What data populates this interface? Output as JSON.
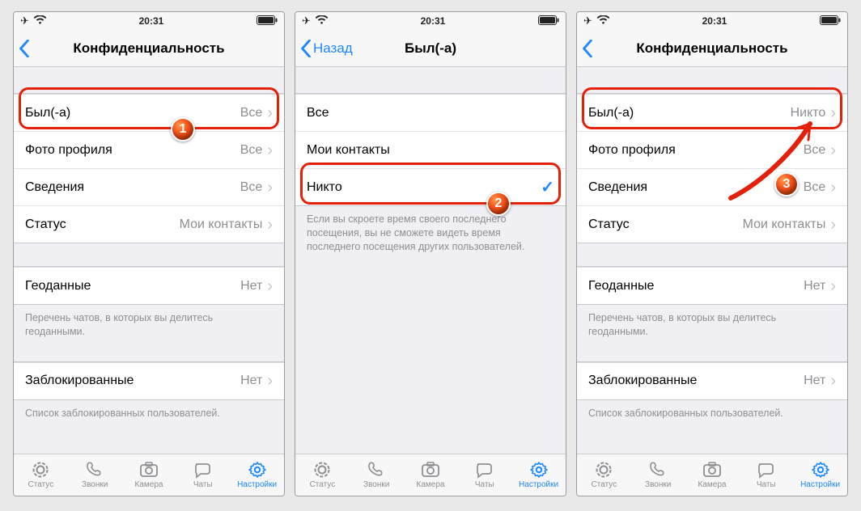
{
  "status": {
    "time": "20:31"
  },
  "titles": {
    "privacy": "Конфиденциальность",
    "back": "Назад",
    "lastseen": "Был(-а)"
  },
  "privacy_rows": {
    "last_seen": "Был(-а)",
    "profile_photo": "Фото профиля",
    "about": "Сведения",
    "status": "Статус",
    "live_location": "Геоданные",
    "blocked": "Заблокированные"
  },
  "values": {
    "all": "Все",
    "contacts": "Мои контакты",
    "none": "Нет",
    "nobody": "Никто"
  },
  "options": {
    "all": "Все",
    "contacts": "Мои контакты",
    "nobody": "Никто"
  },
  "notes": {
    "lastseen_hide": "Если вы скроете время своего последнего посещения, вы не сможете видеть время последнего посещения других пользователей.",
    "geo": "Перечень чатов, в которых вы делитесь геоданными.",
    "blocked": "Список заблокированных пользователей."
  },
  "tabs": {
    "status": "Статус",
    "calls": "Звонки",
    "camera": "Камера",
    "chats": "Чаты",
    "settings": "Настройки"
  },
  "badges": {
    "b1": "1",
    "b2": "2",
    "b3": "3"
  }
}
